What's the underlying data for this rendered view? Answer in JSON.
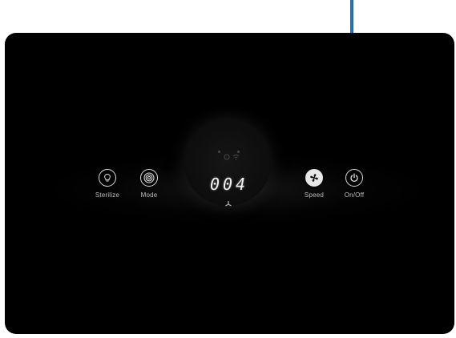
{
  "panel": {
    "display_value": "004",
    "controls": [
      {
        "key": "sterilize",
        "label": "Sterilize",
        "icon": "bulb-icon"
      },
      {
        "key": "mode",
        "label": "Mode",
        "icon": "mode-rings-icon"
      },
      {
        "key": "speed",
        "label": "Speed",
        "icon": "fan-icon"
      },
      {
        "key": "onoff",
        "label": "On/Off",
        "icon": "power-icon"
      }
    ]
  },
  "colors": {
    "panel_bg": "#000000",
    "page_bg": "#ffffff",
    "icon_stroke": "#dcdcdc",
    "label_text": "#bfbfbf",
    "arrow": "#1f6fb2"
  }
}
